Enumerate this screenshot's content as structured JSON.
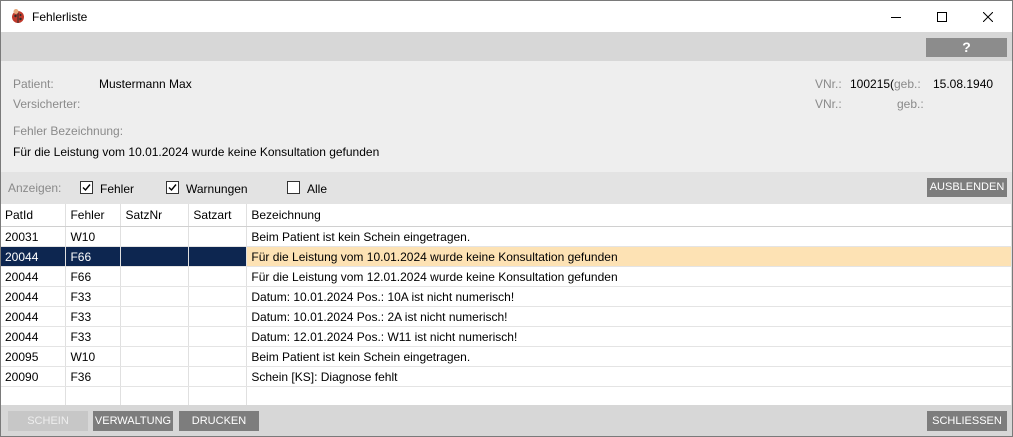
{
  "window": {
    "title": "Fehlerliste"
  },
  "toolbar": {
    "help_label": "?"
  },
  "patient": {
    "label_patient": "Patient:",
    "name": "Mustermann Max",
    "label_versicherter": "Versicherter:",
    "label_vnr": "VNr.:",
    "vnr": "100215(",
    "label_geb": "geb.:",
    "geb": "15.08.1940",
    "label_vnr2": "VNr.:",
    "label_geb2": "geb.:"
  },
  "error": {
    "label": "Fehler Bezeichnung:",
    "text": "Für die Leistung vom 10.01.2024 wurde keine Konsultation gefunden"
  },
  "filter": {
    "label": "Anzeigen:",
    "fehler": {
      "label": "Fehler",
      "checked": true
    },
    "warnungen": {
      "label": "Warnungen",
      "checked": true
    },
    "alle": {
      "label": "Alle",
      "checked": false
    },
    "hide_button": "AUSBLENDEN"
  },
  "table": {
    "columns": [
      "PatId",
      "Fehler",
      "SatzNr",
      "Satzart",
      "Bezeichnung"
    ],
    "rows": [
      {
        "patid": "20031",
        "fehler": "W10",
        "satznr": "",
        "satzart": "",
        "bezeichnung": "Beim Patient ist kein Schein eingetragen."
      },
      {
        "patid": "20044",
        "fehler": "F66",
        "satznr": "",
        "satzart": "",
        "bezeichnung": "Für die Leistung vom 10.01.2024 wurde keine Konsultation gefunden"
      },
      {
        "patid": "20044",
        "fehler": "F66",
        "satznr": "",
        "satzart": "",
        "bezeichnung": "Für die Leistung vom 12.01.2024 wurde keine Konsultation gefunden"
      },
      {
        "patid": "20044",
        "fehler": "F33",
        "satznr": "",
        "satzart": "",
        "bezeichnung": "Datum: 10.01.2024 Pos.: 10A ist nicht numerisch!"
      },
      {
        "patid": "20044",
        "fehler": "F33",
        "satznr": "",
        "satzart": "",
        "bezeichnung": "Datum: 10.01.2024 Pos.: 2A ist nicht numerisch!"
      },
      {
        "patid": "20044",
        "fehler": "F33",
        "satznr": "",
        "satzart": "",
        "bezeichnung": "Datum: 12.01.2024 Pos.: W11 ist nicht numerisch!"
      },
      {
        "patid": "20095",
        "fehler": "W10",
        "satznr": "",
        "satzart": "",
        "bezeichnung": "Beim Patient ist kein Schein eingetragen."
      },
      {
        "patid": "20090",
        "fehler": "F36",
        "satznr": "",
        "satzart": "",
        "bezeichnung": "Schein [KS]: Diagnose fehlt"
      }
    ],
    "selected_row": 1
  },
  "buttons": {
    "schein": "SCHEIN",
    "verwaltung": "VERWALTUNG",
    "drucken": "DRUCKEN",
    "schliessen": "SCHLIESSEN"
  },
  "icons": {
    "app": "ladybug-icon",
    "minimize": "minimize-icon",
    "maximize": "maximize-icon",
    "close": "close-icon"
  },
  "colors": {
    "selection": "#0d2650",
    "highlight": "#fde2b4"
  }
}
